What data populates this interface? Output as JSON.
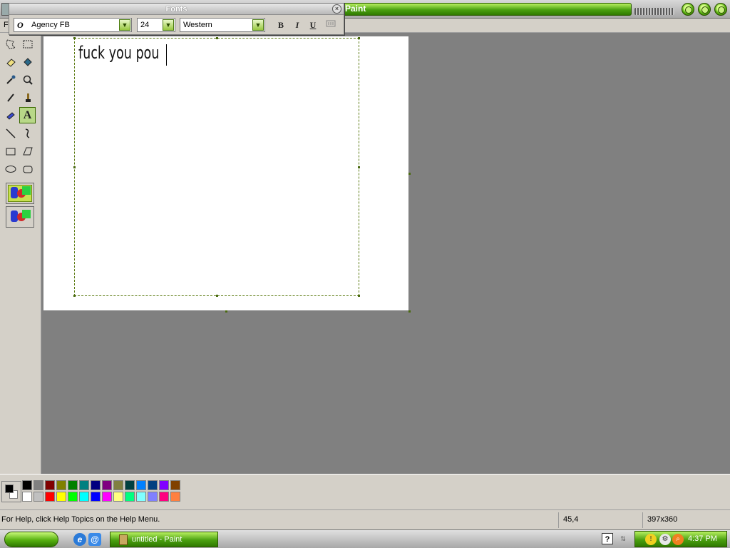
{
  "window": {
    "title": "Paint",
    "menu_first_letter": "F"
  },
  "fonts_toolbar": {
    "title": "Fonts",
    "font_name": "Agency FB",
    "font_size": "24",
    "script": "Western",
    "bold_label": "B",
    "italic_label": "I",
    "underline_label": "U"
  },
  "canvas": {
    "text": "fuck you pou"
  },
  "palette": {
    "foreground": "#000000",
    "background": "#ffffff",
    "row1": [
      "#000000",
      "#808080",
      "#800000",
      "#808000",
      "#008000",
      "#008080",
      "#000080",
      "#800080",
      "#808040",
      "#004040",
      "#0080ff",
      "#004080",
      "#8000ff",
      "#804000"
    ],
    "row2": [
      "#ffffff",
      "#c0c0c0",
      "#ff0000",
      "#ffff00",
      "#00ff00",
      "#00ffff",
      "#0000ff",
      "#ff00ff",
      "#ffff80",
      "#00ff80",
      "#80ffff",
      "#8080ff",
      "#ff0080",
      "#ff8040"
    ]
  },
  "status": {
    "help": "For Help, click Help Topics on the Help Menu.",
    "coords": "45,4",
    "size": "397x360"
  },
  "taskbar": {
    "task_label": "untitled - Paint",
    "clock": "4:37 PM",
    "help_icon_label": "?"
  }
}
